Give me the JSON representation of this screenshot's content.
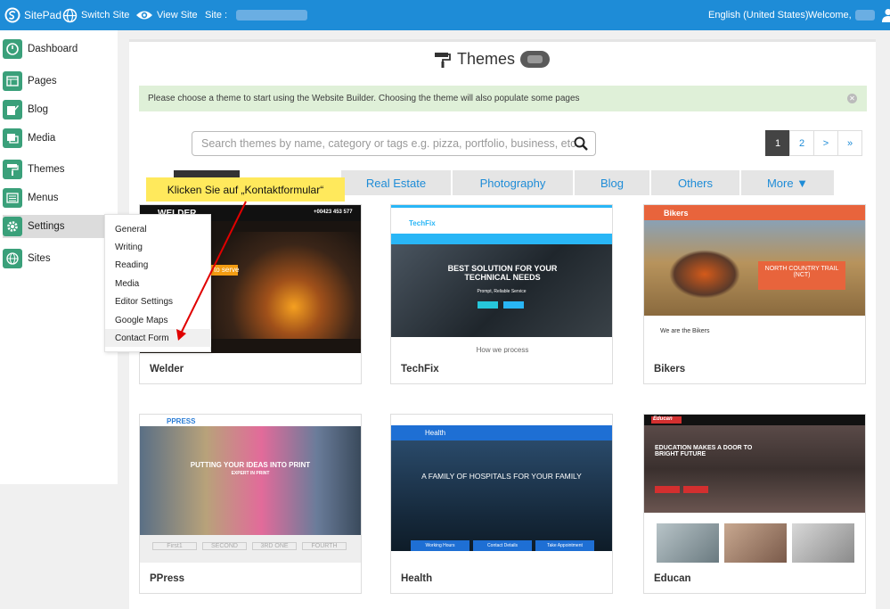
{
  "topbar": {
    "logo": "SitePad",
    "switch_site": "Switch Site",
    "view_site": "View Site",
    "site_label": "Site :",
    "language": "English (United States)",
    "welcome": "Welcome,"
  },
  "sidebar": {
    "items": [
      {
        "label": "Dashboard",
        "icon": "dashboard-icon"
      },
      {
        "label": "Pages",
        "icon": "pages-icon"
      },
      {
        "label": "Blog",
        "icon": "blog-icon"
      },
      {
        "label": "Media",
        "icon": "media-icon"
      },
      {
        "label": "Themes",
        "icon": "paint-roller-icon"
      },
      {
        "label": "Menus",
        "icon": "menus-icon"
      },
      {
        "label": "Settings",
        "icon": "gear-icon"
      },
      {
        "label": "Sites",
        "icon": "globe-icon"
      }
    ]
  },
  "settings_menu": [
    "General",
    "Writing",
    "Reading",
    "Media",
    "Editor Settings",
    "Google Maps",
    "Contact Form"
  ],
  "page": {
    "title": "Themes",
    "alert": "Please choose a theme to start using the Website Builder. Choosing the theme will also populate some pages",
    "search_placeholder": "Search themes by name, category or tags e.g. pizza, portfolio, business, etc"
  },
  "pagination": [
    "1",
    "2",
    ">",
    "»"
  ],
  "tabs": [
    "Real Estate",
    "Photography",
    "Blog",
    "Others",
    "More ▼"
  ],
  "callout": "Klicken Sie auf „Kontaktformular“",
  "themes": [
    {
      "name": "Welder",
      "preview_title": "WELDER",
      "preview_contact": "+00423 453 577",
      "preview_button": "to serve"
    },
    {
      "name": "TechFix",
      "preview_logo": "TechFix",
      "preview_heading": "BEST SOLUTION FOR YOUR TECHNICAL NEEDS",
      "preview_sub": "Prompt, Reliable Service",
      "preview_below": "How we process"
    },
    {
      "name": "Bikers",
      "preview_logo": "Bikers",
      "preview_heading": "NORTH COUNTRY TRAIL (NCT)",
      "preview_below": "We are the Bikers"
    },
    {
      "name": "PPress",
      "preview_logo": "PPRESS",
      "preview_heading": "PUTTING YOUR IDEAS INTO PRINT",
      "preview_sub": "EXPERT IN PRINT",
      "preview_steps": [
        "First1",
        "SECOND",
        "3RD ONE",
        "FOURTH"
      ]
    },
    {
      "name": "Health",
      "preview_logo": "Health",
      "preview_heading": "A FAMILY OF HOSPITALS FOR YOUR FAMILY",
      "preview_bars": [
        "Working Hours",
        "Contact Details",
        "Take Appointment"
      ]
    },
    {
      "name": "Educan",
      "preview_logo": "Educan",
      "preview_heading": "EDUCATION MAKES A DOOR TO BRIGHT FUTURE"
    }
  ],
  "colors": {
    "topbar": "#1e8cd7",
    "icon_green": "#3aa07a",
    "callout": "#ffe95c",
    "arrow": "#e00000",
    "alert_bg": "#dff0d8"
  }
}
